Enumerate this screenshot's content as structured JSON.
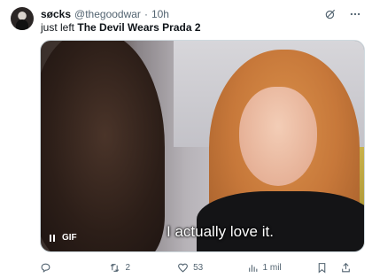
{
  "tweet": {
    "author_name": "søcks",
    "handle": "@thegoodwar",
    "separator": "·",
    "time": "10h",
    "text_prefix": "just left ",
    "text_bold": "The Devil Wears Prada 2"
  },
  "media": {
    "caption": "I actually love it.",
    "badge": "GIF",
    "paused": false
  },
  "actions": {
    "replies": "",
    "reposts": "2",
    "likes": "53",
    "views": "1 mil"
  },
  "icons": {
    "header": [
      "grok-icon",
      "more-icon"
    ],
    "actions": [
      "reply-icon",
      "repost-icon",
      "like-icon",
      "views-icon",
      "bookmark-icon",
      "share-icon"
    ]
  },
  "colors": {
    "text": "#0f1419",
    "secondary": "#536471",
    "border": "#cfd9de"
  }
}
